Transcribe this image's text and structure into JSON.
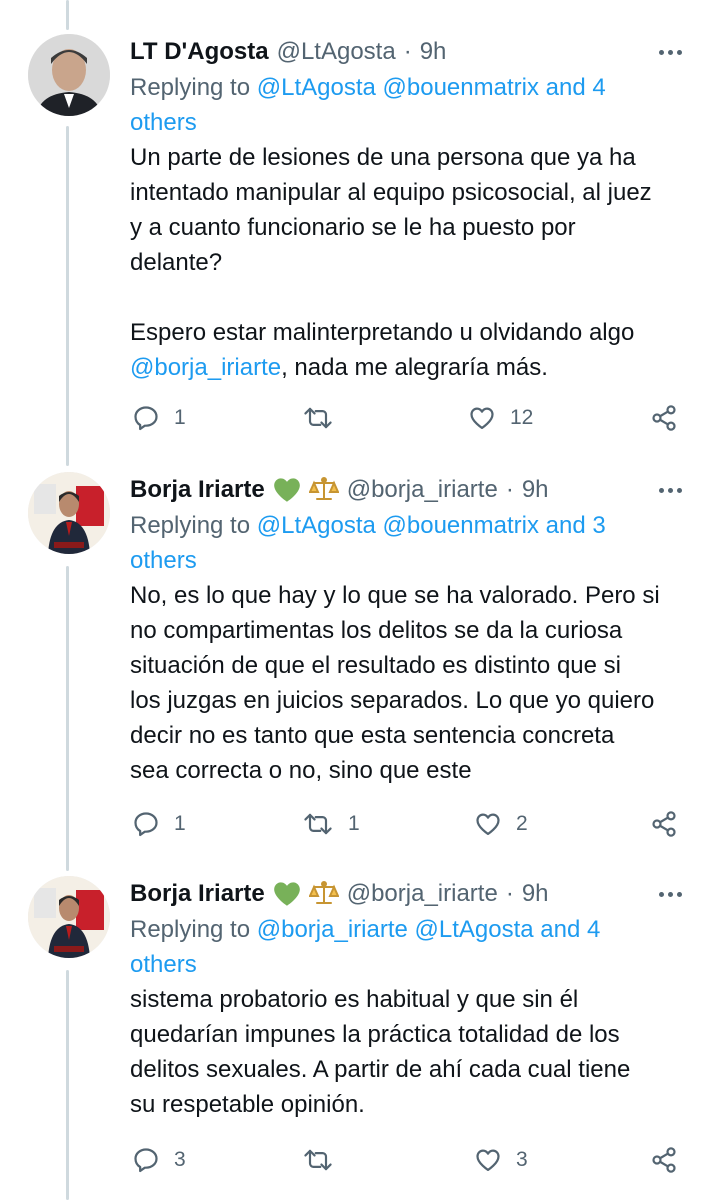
{
  "tweets": [
    {
      "name": "LT D'Agosta",
      "handle": "@LtAgosta",
      "time": "9h",
      "reply_prefix": "Replying to",
      "mentions": "@LtAgosta @bouenmatrix and 4",
      "mentions_line2": "others",
      "text_lines": [
        "Un parte de lesiones de una persona que ya ha",
        "intentado manipular al equipo psicosocial, al juez",
        "y a cuanto funcionario se le ha puesto por",
        "delante?"
      ],
      "text_lines_b": [
        "Espero estar malinterpretando u olvidando algo"
      ],
      "mention_inline": "@borja_iriarte",
      "text_after_mention": ", nada me alegraría más.",
      "replies": "1",
      "retweets": "",
      "likes": "12"
    },
    {
      "name": "Borja Iriarte",
      "badges": "💚 ⚖️",
      "handle": "@borja_iriarte",
      "time": "9h",
      "reply_prefix": "Replying to",
      "mentions": "@LtAgosta @bouenmatrix and 3",
      "mentions_line2": "others",
      "text_lines": [
        "No, es lo que hay y lo que se ha valorado. Pero si",
        "no compartimentas los delitos se da la curiosa",
        "situación de que el resultado es distinto que si",
        "los juzgas en juicios separados. Lo que yo quiero",
        "decir no es tanto que esta sentencia concreta",
        "sea correcta o no, sino que este"
      ],
      "replies": "1",
      "retweets": "1",
      "likes": "2"
    },
    {
      "name": "Borja Iriarte",
      "badges": "💚 ⚖️",
      "handle": "@borja_iriarte",
      "time": "9h",
      "reply_prefix": "Replying to",
      "mentions": "@borja_iriarte @LtAgosta and 4",
      "mentions_line2": "others",
      "text_lines": [
        "sistema probatorio es habitual y que sin él",
        "quedarían impunes la práctica totalidad de los",
        "delitos sexuales. A partir de ahí cada cual tiene",
        "su respetable opinión."
      ],
      "replies": "3",
      "retweets": "",
      "likes": "3"
    }
  ],
  "separator": "·",
  "colors": {
    "link": "#1d9bf0",
    "secondary": "#536471",
    "text": "#0f1419",
    "thread_line": "#cfd9de"
  },
  "icons": [
    "reply-icon",
    "retweet-icon",
    "like-icon",
    "share-icon",
    "more-icon",
    "green-heart-icon",
    "scales-icon"
  ]
}
